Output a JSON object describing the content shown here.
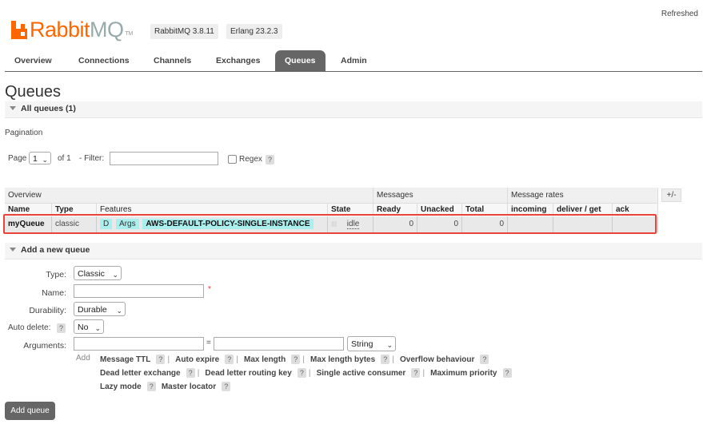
{
  "header": {
    "logo_text": "Rabbit",
    "logo_mq": "MQ",
    "logo_tm": "TM",
    "rabbitmq_version": "RabbitMQ 3.8.11",
    "erlang_version": "Erlang 23.2.3",
    "refreshed_text": "Refreshed",
    "brand_color": "#ff6600"
  },
  "tabs": [
    {
      "label": "Overview"
    },
    {
      "label": "Connections"
    },
    {
      "label": "Channels"
    },
    {
      "label": "Exchanges"
    },
    {
      "label": "Queues",
      "active": true
    },
    {
      "label": "Admin"
    }
  ],
  "page": {
    "title": "Queues",
    "all_queues_label": "All queues (1)",
    "pagination_label": "Pagination",
    "page_label": "Page",
    "page_value": "1",
    "of_label": "of 1",
    "filter_label": "- Filter:",
    "filter_value": "",
    "regex_label": "Regex",
    "help": "?"
  },
  "table": {
    "group_overview": "Overview",
    "group_messages": "Messages",
    "group_rates": "Message rates",
    "plus_minus": "+/-",
    "headers": {
      "name": "Name",
      "type": "Type",
      "features": "Features",
      "state": "State",
      "ready": "Ready",
      "unacked": "Unacked",
      "total": "Total",
      "incoming": "incoming",
      "deliver_get": "deliver / get",
      "ack": "ack"
    },
    "rows": [
      {
        "name": "myQueue",
        "type": "classic",
        "feature_d": "D",
        "feature_args": "Args",
        "policy": "AWS-DEFAULT-POLICY-SINGLE-INSTANCE",
        "state": "idle",
        "ready": "0",
        "unacked": "0",
        "total": "0",
        "incoming": "",
        "deliver_get": "",
        "ack": ""
      }
    ]
  },
  "add_queue": {
    "section_label": "Add a new queue",
    "type_label": "Type:",
    "type_value": "Classic",
    "name_label": "Name:",
    "name_value": "",
    "required_mark": "*",
    "durability_label": "Durability:",
    "durability_value": "Durable",
    "auto_delete_label": "Auto delete:",
    "auto_delete_value": "No",
    "arguments_label": "Arguments:",
    "equals": "=",
    "arg_type_value": "String",
    "add_label": "Add",
    "options": {
      "message_ttl": "Message TTL",
      "auto_expire": "Auto expire",
      "max_length": "Max length",
      "max_length_bytes": "Max length bytes",
      "overflow_behaviour": "Overflow behaviour",
      "dead_letter_exchange": "Dead letter exchange",
      "dead_letter_routing_key": "Dead letter routing key",
      "single_active_consumer": "Single active consumer",
      "maximum_priority": "Maximum priority",
      "lazy_mode": "Lazy mode",
      "master_locator": "Master locator"
    },
    "separator": "|",
    "button_label": "Add queue"
  }
}
